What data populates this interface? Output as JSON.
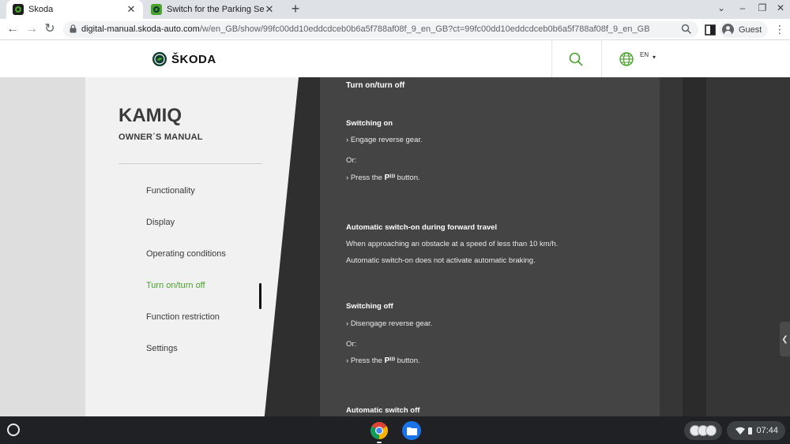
{
  "browser": {
    "tabs": [
      {
        "title": "Skoda",
        "active": true
      },
      {
        "title": "Switch for the Parking Sensors S",
        "active": false
      }
    ],
    "url_host": "digital-manual.skoda-auto.com",
    "url_path": "/w/en_GB/show/99fc00dd10eddcdceb0b6a5f788af08f_9_en_GB?ct=99fc00dd10eddcdceb0b6a5f788af08f_9_en_GB",
    "profile_label": "Guest",
    "icons": [
      "back-icon",
      "forward-icon",
      "reload-icon",
      "lock-icon",
      "zoom-icon",
      "side-panel-icon",
      "menu-icon"
    ]
  },
  "site": {
    "brand": "ŠKODA",
    "language": "EN",
    "accent_color": "#4aa32d"
  },
  "sidebar": {
    "title": "KAMIQ",
    "subtitle": "OWNER´S MANUAL",
    "items": [
      {
        "label": "Functionality",
        "active": false
      },
      {
        "label": "Display",
        "active": false
      },
      {
        "label": "Operating conditions",
        "active": false
      },
      {
        "label": "Turn on/turn off",
        "active": true
      },
      {
        "label": "Function restriction",
        "active": false
      },
      {
        "label": "Settings",
        "active": false
      }
    ]
  },
  "content": {
    "title": "Turn on/turn off",
    "switching_on": {
      "heading": "Switching on",
      "step1": "Engage reverse gear.",
      "or": "Or:",
      "step2_before": "Press the",
      "step2_after": "button."
    },
    "auto_on": {
      "heading": "Automatic switch-on during forward travel",
      "line1": "When approaching an obstacle at a speed of less than 10 km/h.",
      "line2": "Automatic switch-on does not activate automatic braking."
    },
    "switching_off": {
      "heading": "Switching off",
      "step1": "Disengage reverse gear.",
      "or": "Or:",
      "step2_before": "Press the",
      "step2_after": "button."
    },
    "auto_off": {
      "heading": "Automatic switch off"
    },
    "button_symbol": "P",
    "button_symbol_suffix": "⁾⁾⁾"
  },
  "shelf": {
    "time": "07:44",
    "apps": [
      "chrome-app-icon",
      "files-app-icon"
    ]
  }
}
